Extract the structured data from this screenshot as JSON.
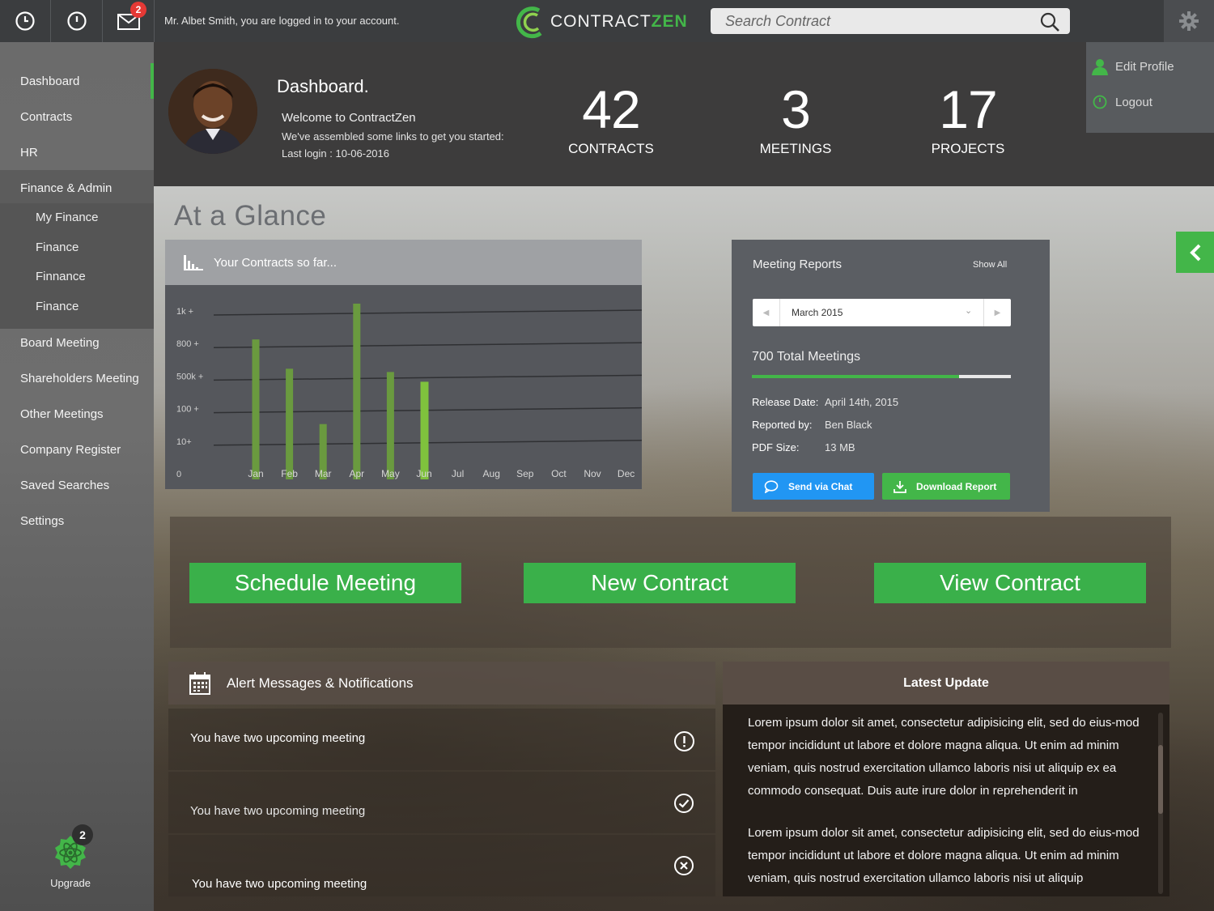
{
  "topbar": {
    "mail_badge": "2",
    "logged_message": "Mr. Albet Smith, you are logged in to your account.",
    "logo_left": "CONTRACT",
    "logo_right": "ZEN",
    "search_placeholder": "Search Contract"
  },
  "sidebar": {
    "items": [
      {
        "label": "Dashboard"
      },
      {
        "label": "Contracts"
      },
      {
        "label": "HR"
      },
      {
        "label": "Finance & Admin"
      },
      {
        "label": "Board Meeting"
      },
      {
        "label": "Shareholders Meeting"
      },
      {
        "label": "Other Meetings"
      },
      {
        "label": "Company Register"
      },
      {
        "label": "Saved Searches"
      },
      {
        "label": "Settings"
      }
    ],
    "sub_items": [
      {
        "label": "My Finance"
      },
      {
        "label": "Finance"
      },
      {
        "label": "Finnance"
      },
      {
        "label": "Finance"
      }
    ],
    "upgrade_label": "Upgrade",
    "upgrade_badge": "2"
  },
  "header": {
    "title": "Dashboard.",
    "welcome": "Welcome to ContractZen",
    "assembled": "We've assembled some links to get you started:",
    "last_login": "Last login : 10-06-2016",
    "stats": [
      {
        "value": "42",
        "label": "CONTRACTS"
      },
      {
        "value": "3",
        "label": "MEETINGS"
      },
      {
        "value": "17",
        "label": "PROJECTS"
      }
    ]
  },
  "profile_menu": {
    "edit": "Edit Profile",
    "logout": "Logout"
  },
  "glance_title": "At  a Glance",
  "chart_card": {
    "title": "Your Contracts so far..."
  },
  "chart_data": {
    "type": "bar",
    "title": "Your Contracts so far...",
    "y_tick_labels": [
      "0",
      "10+",
      "100 +",
      "500k +",
      "800 +",
      "1k +"
    ],
    "categories": [
      "Jan",
      "Feb",
      "Mar",
      "Apr",
      "May",
      "Jun",
      "Jul",
      "Aug",
      "Sep",
      "Oct",
      "Nov",
      "Dec"
    ],
    "values": [
      4.1,
      3.2,
      1.5,
      5.2,
      3.1,
      2.8,
      null,
      null,
      null,
      null,
      null,
      null
    ],
    "ylim": [
      0,
      5
    ],
    "highlight": "Jun",
    "colors": {
      "bar": "#6a9a3f",
      "highlight": "#7fc23d",
      "grid": "#2f3033"
    },
    "grid": true,
    "legend": "none"
  },
  "meetings": {
    "title": "Meeting Reports",
    "show_all": "Show All",
    "month": "March 2015",
    "total": "700 Total Meetings",
    "progress": 0.8,
    "release_label": "Release Date:",
    "release_value": "April 14th, 2015",
    "reported_label": "Reported by:",
    "reported_value": "Ben Black",
    "size_label": "PDF Size:",
    "size_value": "13 MB",
    "send_label": "Send via Chat",
    "download_label": "Download Report"
  },
  "actions": {
    "schedule": "Schedule Meeting",
    "new_contract": "New Contract",
    "view_contract": "View Contract"
  },
  "alerts": {
    "title": "Alert Messages & Notifications",
    "rows": [
      {
        "text": "You have two upcoming meeting",
        "icon": "alert-icon"
      },
      {
        "text": "You have two upcoming meeting",
        "icon": "check-icon"
      },
      {
        "text": "You have two upcoming meeting",
        "icon": "close-icon"
      }
    ]
  },
  "latest": {
    "title": "Latest Update",
    "paragraphs": [
      "Lorem ipsum dolor sit amet, consectetur adipisicing elit, sed do eius-mod tempor incididunt ut labore et dolore magna aliqua. Ut enim ad minim veniam, quis nostrud exercitation ullamco laboris nisi ut aliquip ex ea commodo consequat. Duis aute irure dolor in reprehenderit in",
      "Lorem ipsum dolor sit amet, consectetur adipisicing elit, sed do eius-mod tempor incididunt ut labore et dolore magna aliqua. Ut enim ad minim veniam, quis nostrud exercitation ullamco laboris nisi ut aliquip"
    ]
  },
  "colors": {
    "accent": "#43b649",
    "blue": "#2196f3",
    "badge": "#e53935"
  }
}
